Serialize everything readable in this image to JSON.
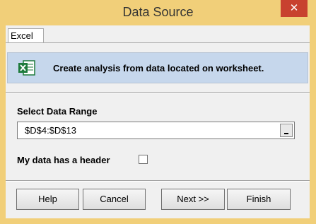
{
  "window": {
    "title": "Data Source",
    "close_glyph": "✕"
  },
  "tab": {
    "label": "Excel"
  },
  "banner": {
    "icon": "excel-icon",
    "text": "Create analysis from data located on worksheet."
  },
  "range": {
    "label": "Select Data Range",
    "value": "$D$4:$D$13"
  },
  "header_option": {
    "label": "My data has a header",
    "checked": false
  },
  "buttons": {
    "help": "Help",
    "cancel": "Cancel",
    "next": "Next >>",
    "finish": "Finish"
  },
  "colors": {
    "frame": "#f1cf79",
    "close": "#c8412f",
    "banner": "#c6d7ec",
    "excel_green": "#1d7a3b"
  }
}
